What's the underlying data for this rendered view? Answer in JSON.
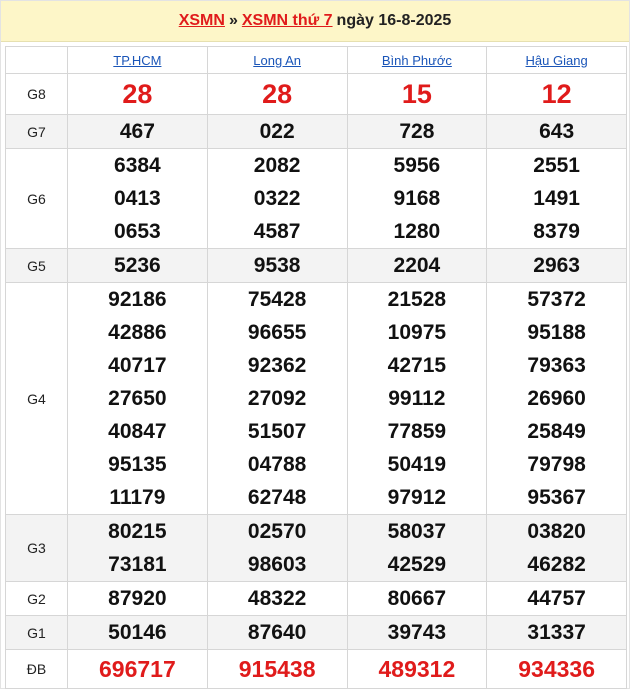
{
  "header": {
    "link1": "XSMN",
    "sep": "»",
    "link2": "XSMN thứ 7",
    "date": "ngày 16-8-2025"
  },
  "provinces": [
    "TP.HCM",
    "Long An",
    "Bình Phước",
    "Hậu Giang"
  ],
  "prizes": [
    {
      "label": "G8",
      "values": [
        [
          "28"
        ],
        [
          "28"
        ],
        [
          "15"
        ],
        [
          "12"
        ]
      ]
    },
    {
      "label": "G7",
      "values": [
        [
          "467"
        ],
        [
          "022"
        ],
        [
          "728"
        ],
        [
          "643"
        ]
      ]
    },
    {
      "label": "G6",
      "values": [
        [
          "6384",
          "0413",
          "0653"
        ],
        [
          "2082",
          "0322",
          "4587"
        ],
        [
          "5956",
          "9168",
          "1280"
        ],
        [
          "2551",
          "1491",
          "8379"
        ]
      ]
    },
    {
      "label": "G5",
      "values": [
        [
          "5236"
        ],
        [
          "9538"
        ],
        [
          "2204"
        ],
        [
          "2963"
        ]
      ]
    },
    {
      "label": "G4",
      "values": [
        [
          "92186",
          "42886",
          "40717",
          "27650",
          "40847",
          "95135",
          "11179"
        ],
        [
          "75428",
          "96655",
          "92362",
          "27092",
          "51507",
          "04788",
          "62748"
        ],
        [
          "21528",
          "10975",
          "42715",
          "99112",
          "77859",
          "50419",
          "97912"
        ],
        [
          "57372",
          "95188",
          "79363",
          "26960",
          "25849",
          "79798",
          "95367"
        ]
      ]
    },
    {
      "label": "G3",
      "values": [
        [
          "80215",
          "73181"
        ],
        [
          "02570",
          "98603"
        ],
        [
          "58037",
          "42529"
        ],
        [
          "03820",
          "46282"
        ]
      ]
    },
    {
      "label": "G2",
      "values": [
        [
          "87920"
        ],
        [
          "48322"
        ],
        [
          "80667"
        ],
        [
          "44757"
        ]
      ]
    },
    {
      "label": "G1",
      "values": [
        [
          "50146"
        ],
        [
          "87640"
        ],
        [
          "39743"
        ],
        [
          "31337"
        ]
      ]
    },
    {
      "label": "ĐB",
      "values": [
        [
          "696717"
        ],
        [
          "915438"
        ],
        [
          "489312"
        ],
        [
          "934336"
        ]
      ]
    }
  ],
  "colors": {
    "red": "#e01b1b",
    "link_blue": "#1a55b8",
    "header_bg": "#fdf6c8",
    "alt_row": "#f3f3f3"
  }
}
